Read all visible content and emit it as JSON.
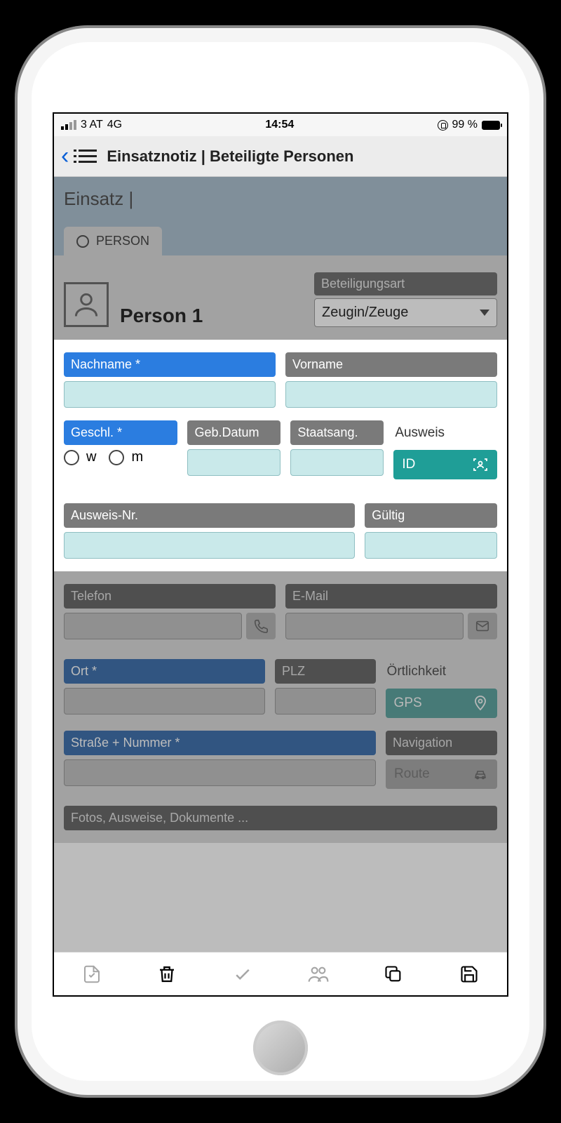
{
  "status": {
    "carrier": "3 AT",
    "network": "4G",
    "time": "14:54",
    "battery_pct": "99 %"
  },
  "nav": {
    "title": "Einsatznotiz | Beteiligte Personen"
  },
  "einsatz": {
    "title": "Einsatz |",
    "tab_label": "PERSON"
  },
  "person": {
    "title": "Person 1",
    "role_label": "Beteiligungsart",
    "role_value": "Zeugin/Zeuge"
  },
  "fields": {
    "nachname": "Nachname *",
    "vorname": "Vorname",
    "geschl": "Geschl. *",
    "gender_w": "w",
    "gender_m": "m",
    "geb_datum": "Geb.Datum",
    "staatsang": "Staatsang.",
    "ausweis": "Ausweis",
    "id_btn": "ID",
    "ausweis_nr": "Ausweis-Nr.",
    "gueltig": "Gültig",
    "telefon": "Telefon",
    "email": "E-Mail",
    "ort": "Ort *",
    "plz": "PLZ",
    "oertlichkeit": "Örtlichkeit",
    "gps_btn": "GPS",
    "strasse": "Straße + Nummer *",
    "navigation": "Navigation",
    "route_btn": "Route",
    "fotos": "Fotos, Ausweise, Dokumente ..."
  }
}
